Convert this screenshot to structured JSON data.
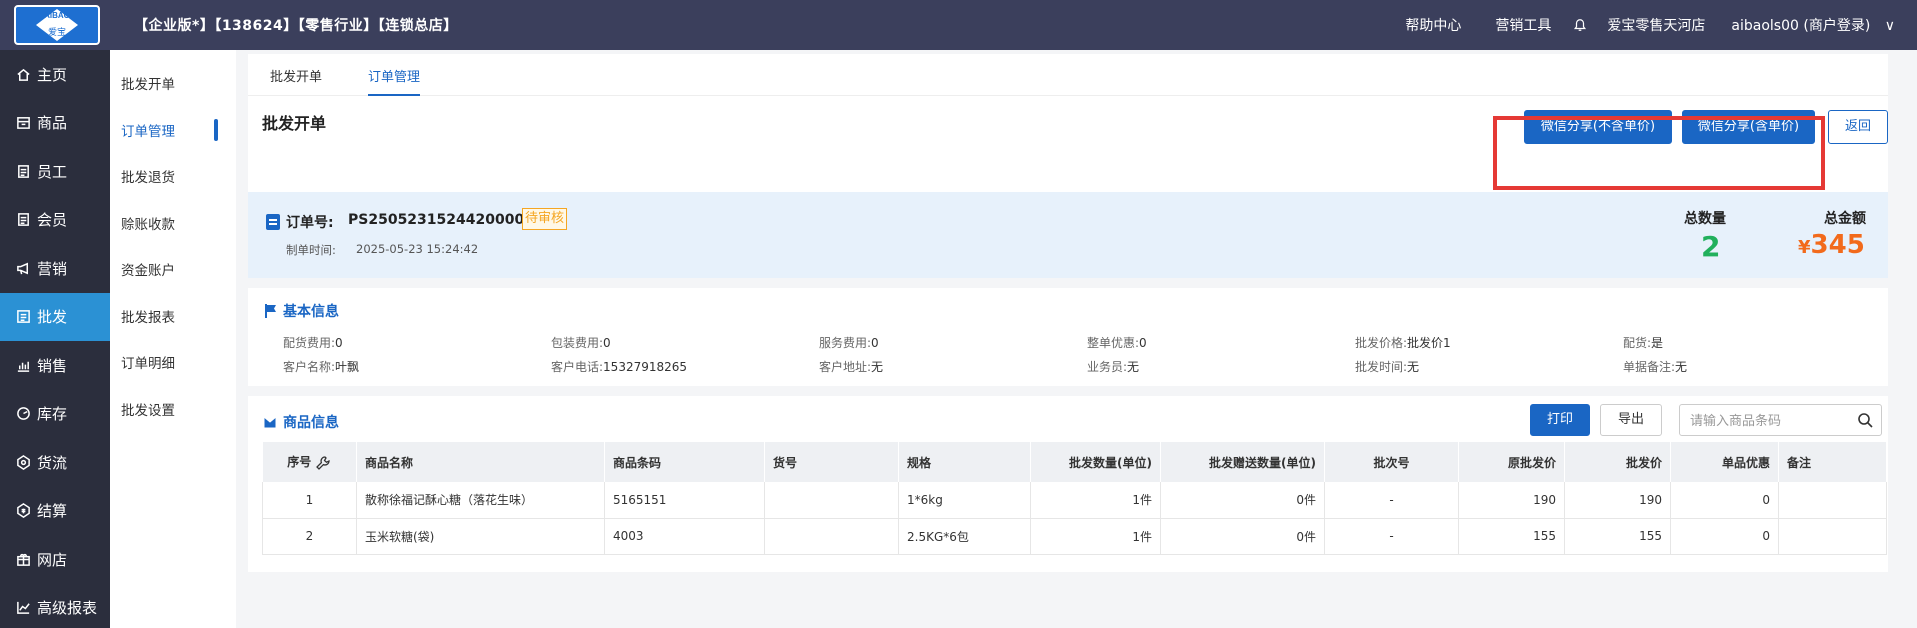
{
  "topbar": {
    "logo_text": "AIBAO",
    "logo_sub": "爱宝",
    "title": "【企业版*】【138624】【零售行业】【连锁总店】",
    "help": "帮助中心",
    "marketing_tools": "营销工具",
    "store": "爱宝零售天河店",
    "user": "aibaols00 (商户登录)",
    "user_caret": "∨"
  },
  "sidebar": {
    "items": [
      {
        "label": "主页",
        "icon": "home-icon"
      },
      {
        "label": "商品",
        "icon": "product-icon"
      },
      {
        "label": "员工",
        "icon": "staff-icon"
      },
      {
        "label": "会员",
        "icon": "member-icon"
      },
      {
        "label": "营销",
        "icon": "marketing-icon"
      },
      {
        "label": "批发",
        "icon": "wholesale-icon"
      },
      {
        "label": "销售",
        "icon": "sales-icon"
      },
      {
        "label": "库存",
        "icon": "inventory-icon"
      },
      {
        "label": "货流",
        "icon": "logistics-icon"
      },
      {
        "label": "结算",
        "icon": "settlement-icon"
      },
      {
        "label": "网店",
        "icon": "shop-icon"
      },
      {
        "label": "高级报表",
        "icon": "report-icon"
      }
    ],
    "active": "批发"
  },
  "subnav": {
    "items": [
      "批发开单",
      "订单管理",
      "批发退货",
      "赊账收款",
      "资金账户",
      "批发报表",
      "订单明细",
      "批发设置"
    ],
    "active": "订单管理"
  },
  "tabs": [
    "批发开单",
    "订单管理"
  ],
  "header": {
    "title": "批发开单",
    "btn_share_no_price": "微信分享(不含单价)",
    "btn_share_price": "微信分享(含单价)",
    "btn_back": "返回"
  },
  "order": {
    "label": "订单号:",
    "number": "PS25052315244200002",
    "status": "待审核",
    "time_label": "制单时间:",
    "time": "2025-05-23 15:24:42",
    "total_qty_label": "总数量",
    "total_qty": "2",
    "total_amt_label": "总金额",
    "currency": "¥",
    "total_amt": "345"
  },
  "basic_info": {
    "title": "基本信息",
    "rows": [
      [
        {
          "label": "配货费用:",
          "value": "0"
        },
        {
          "label": "包装费用:",
          "value": "0"
        },
        {
          "label": "服务费用:",
          "value": "0"
        },
        {
          "label": "整单优惠:",
          "value": "0"
        },
        {
          "label": "批发价格:",
          "value": "批发价1"
        },
        {
          "label": "配货:",
          "value": "是"
        }
      ],
      [
        {
          "label": "客户名称:",
          "value": "叶飘"
        },
        {
          "label": "客户电话:",
          "value": "15327918265"
        },
        {
          "label": "客户地址:",
          "value": "无"
        },
        {
          "label": "业务员:",
          "value": "无"
        },
        {
          "label": "批发时间:",
          "value": "无"
        },
        {
          "label": "单据备注:",
          "value": "无"
        }
      ]
    ]
  },
  "goods": {
    "title": "商品信息",
    "btn_print": "打印",
    "btn_export": "导出",
    "search_placeholder": "请输入商品条码",
    "columns": [
      "序号",
      "商品名称",
      "商品条码",
      "货号",
      "规格",
      "批发数量(单位)",
      "批发赠送数量(单位)",
      "批次号",
      "原批发价",
      "批发价",
      "单品优惠",
      "备注"
    ],
    "rows": [
      [
        "1",
        "散称徐福记酥心糖（落花生味）",
        "5165151",
        "",
        "1*6kg",
        "1件",
        "0件",
        "-",
        "190",
        "190",
        "0",
        ""
      ],
      [
        "2",
        "玉米软糖(袋)",
        "4003",
        "",
        "2.5KG*6包",
        "1件",
        "0件",
        "-",
        "155",
        "155",
        "0",
        ""
      ]
    ]
  },
  "colors": {
    "topbar": "#3b3f5c",
    "sidebar": "#2b2e3d",
    "active_nav": "#2b91d4",
    "primary": "#1a66c4",
    "qty_green": "#21b05c",
    "amount_orange": "#f26a1b",
    "highlight_red": "#e53935"
  }
}
